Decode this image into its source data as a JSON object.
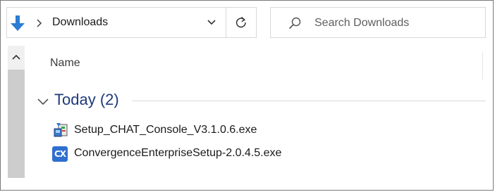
{
  "address_bar": {
    "location": "Downloads",
    "nav_icon": "down-arrow-icon",
    "dropdown_icon": "chevron-down-icon",
    "refresh_icon": "refresh-icon"
  },
  "search": {
    "placeholder": "Search Downloads",
    "icon": "search-icon"
  },
  "columns": {
    "name_label": "Name"
  },
  "groups": [
    {
      "title": "Today (2)",
      "items": [
        {
          "name": "Setup_CHAT_Console_V3.1.0.6.exe",
          "icon": "installer-icon"
        },
        {
          "name": "ConvergenceEnterpriseSetup-2.0.4.5.exe",
          "icon": "cx-app-icon",
          "icon_text": "CX"
        }
      ]
    }
  ],
  "colors": {
    "accent": "#1f3a7a",
    "nav_arrow": "#2b7cd3",
    "cx_badge": "#2f6fcf"
  }
}
